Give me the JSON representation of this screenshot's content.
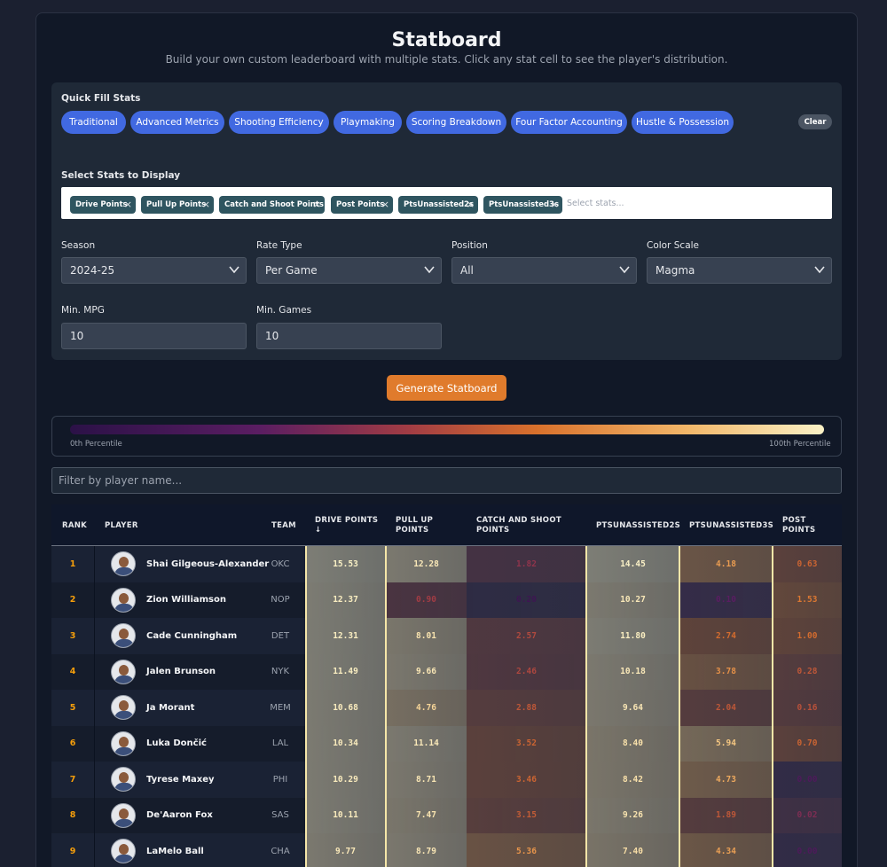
{
  "header": {
    "title": "Statboard",
    "subtitle": "Build your own custom leaderboard with multiple stats. Click any stat cell to see the player's distribution."
  },
  "quick_fill": {
    "label": "Quick Fill Stats",
    "buttons": [
      "Traditional",
      "Advanced Metrics",
      "Shooting Efficiency",
      "Playmaking",
      "Scoring Breakdown",
      "Four Factor Accounting",
      "Hustle & Possession"
    ],
    "clear_label": "Clear"
  },
  "stats_select": {
    "label": "Select Stats to Display",
    "chips": [
      "Drive Points",
      "Pull Up Points",
      "Catch and Shoot Points",
      "Post Points",
      "PtsUnassisted2s",
      "PtsUnassisted3s"
    ],
    "remove_glyph": "×",
    "placeholder": "Select stats..."
  },
  "filters": {
    "season": {
      "label": "Season",
      "value": "2024-25"
    },
    "rate_type": {
      "label": "Rate Type",
      "value": "Per Game"
    },
    "position": {
      "label": "Position",
      "value": "All"
    },
    "color_scale": {
      "label": "Color Scale",
      "value": "Magma"
    },
    "min_mpg": {
      "label": "Min. MPG",
      "value": "10"
    },
    "min_games": {
      "label": "Min. Games",
      "value": "10"
    }
  },
  "generate_label": "Generate Statboard",
  "legend": {
    "low_label": "0th Percentile",
    "high_label": "100th Percentile",
    "scale": "magma"
  },
  "filter_placeholder": "Filter by player name...",
  "table": {
    "headers": {
      "rank": "RANK",
      "player": "PLAYER",
      "team": "TEAM",
      "stat_cols": [
        {
          "line1": "DRIVE POINTS",
          "line2": "↓"
        },
        {
          "line1": "PULL UP",
          "line2": "POINTS"
        },
        {
          "line1": "CATCH AND SHOOT",
          "line2": "POINTS"
        },
        {
          "line1": "PTSUNASSISTED2S",
          "line2": ""
        },
        {
          "line1": "PTSUNASSISTED3S",
          "line2": ""
        },
        {
          "line1": "POST",
          "line2": "POINTS"
        }
      ]
    },
    "rows": [
      {
        "rank": "1",
        "player": "Shai Gilgeous-Alexander",
        "team": "OKC",
        "stats": [
          "15.53",
          "12.28",
          "1.82",
          "14.45",
          "4.18",
          "0.63"
        ],
        "pct": [
          1.0,
          0.97,
          0.35,
          1.0,
          0.72,
          0.55
        ]
      },
      {
        "rank": "2",
        "player": "Zion Williamson",
        "team": "NOP",
        "stats": [
          "12.37",
          "0.90",
          "0.20",
          "10.27",
          "0.10",
          "1.53"
        ],
        "pct": [
          0.99,
          0.4,
          0.08,
          0.97,
          0.2,
          0.62
        ]
      },
      {
        "rank": "3",
        "player": "Cade Cunningham",
        "team": "DET",
        "stats": [
          "12.31",
          "8.01",
          "2.57",
          "11.80",
          "2.74",
          "1.00"
        ],
        "pct": [
          0.99,
          0.95,
          0.45,
          0.99,
          0.58,
          0.58
        ]
      },
      {
        "rank": "4",
        "player": "Jalen Brunson",
        "team": "NYK",
        "stats": [
          "11.49",
          "9.66",
          "2.46",
          "10.18",
          "3.78",
          "0.28"
        ],
        "pct": [
          0.99,
          0.96,
          0.44,
          0.97,
          0.69,
          0.5
        ]
      },
      {
        "rank": "5",
        "player": "Ja Morant",
        "team": "MEM",
        "stats": [
          "10.68",
          "4.76",
          "2.88",
          "9.64",
          "2.04",
          "0.16"
        ],
        "pct": [
          0.98,
          0.9,
          0.5,
          0.96,
          0.5,
          0.48
        ]
      },
      {
        "rank": "6",
        "player": "Luka Dončić",
        "team": "LAL",
        "stats": [
          "10.34",
          "11.14",
          "3.52",
          "8.40",
          "5.94",
          "0.70"
        ],
        "pct": [
          0.98,
          0.97,
          0.55,
          0.94,
          0.85,
          0.55
        ]
      },
      {
        "rank": "7",
        "player": "Tyrese Maxey",
        "team": "PHI",
        "stats": [
          "10.29",
          "8.71",
          "3.46",
          "8.42",
          "4.73",
          "0.00"
        ],
        "pct": [
          0.98,
          0.96,
          0.55,
          0.94,
          0.76,
          0.15
        ]
      },
      {
        "rank": "8",
        "player": "De'Aaron Fox",
        "team": "SAS",
        "stats": [
          "10.11",
          "7.47",
          "3.15",
          "9.26",
          "1.89",
          "0.02"
        ],
        "pct": [
          0.98,
          0.95,
          0.52,
          0.95,
          0.5,
          0.3
        ]
      },
      {
        "rank": "9",
        "player": "LaMelo Ball",
        "team": "CHA",
        "stats": [
          "9.77",
          "8.79",
          "5.36",
          "7.40",
          "4.34",
          "0.00"
        ],
        "pct": [
          0.97,
          0.96,
          0.7,
          0.93,
          0.73,
          0.15
        ]
      }
    ]
  }
}
